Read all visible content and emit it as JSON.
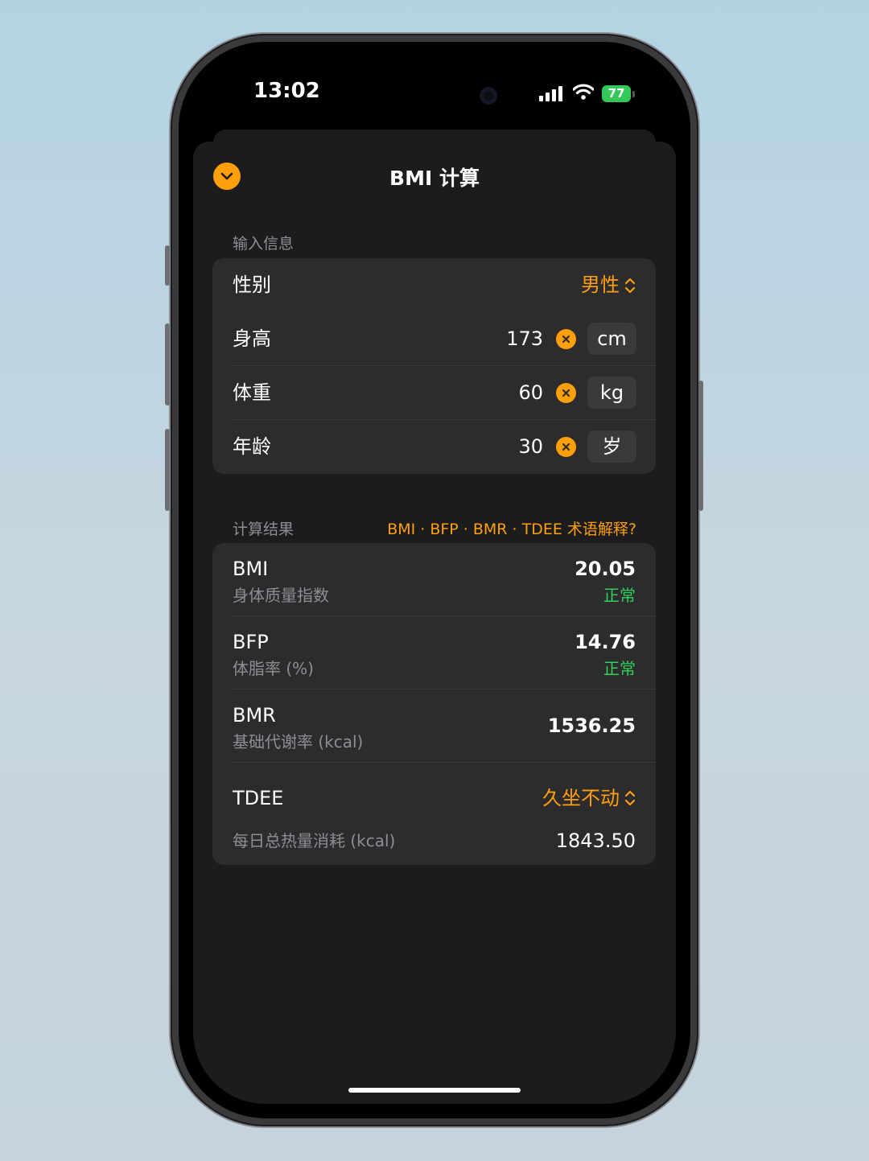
{
  "status_bar": {
    "time": "13:02",
    "battery": "77"
  },
  "sheet": {
    "title": "BMI 计算"
  },
  "input_section": {
    "label": "输入信息",
    "gender": {
      "label": "性别",
      "value": "男性"
    },
    "height": {
      "label": "身高",
      "value": "173",
      "unit": "cm"
    },
    "weight": {
      "label": "体重",
      "value": "60",
      "unit": "kg"
    },
    "age": {
      "label": "年龄",
      "value": "30",
      "unit": "岁"
    }
  },
  "result_section": {
    "label": "计算结果",
    "help_link": "BMI · BFP · BMR · TDEE 术语解释?",
    "bmi": {
      "name": "BMI",
      "desc": "身体质量指数",
      "value": "20.05",
      "status": "正常"
    },
    "bfp": {
      "name": "BFP",
      "desc": "体脂率 (%)",
      "value": "14.76",
      "status": "正常"
    },
    "bmr": {
      "name": "BMR",
      "desc": "基础代谢率 (kcal)",
      "value": "1536.25"
    },
    "tdee": {
      "name": "TDEE",
      "activity": "久坐不动",
      "desc": "每日总热量消耗 (kcal)",
      "value": "1843.50"
    }
  },
  "colors": {
    "accent": "#ff9f0a",
    "normal": "#30d158",
    "card": "#2c2c2e",
    "sheet": "#1c1c1e"
  }
}
